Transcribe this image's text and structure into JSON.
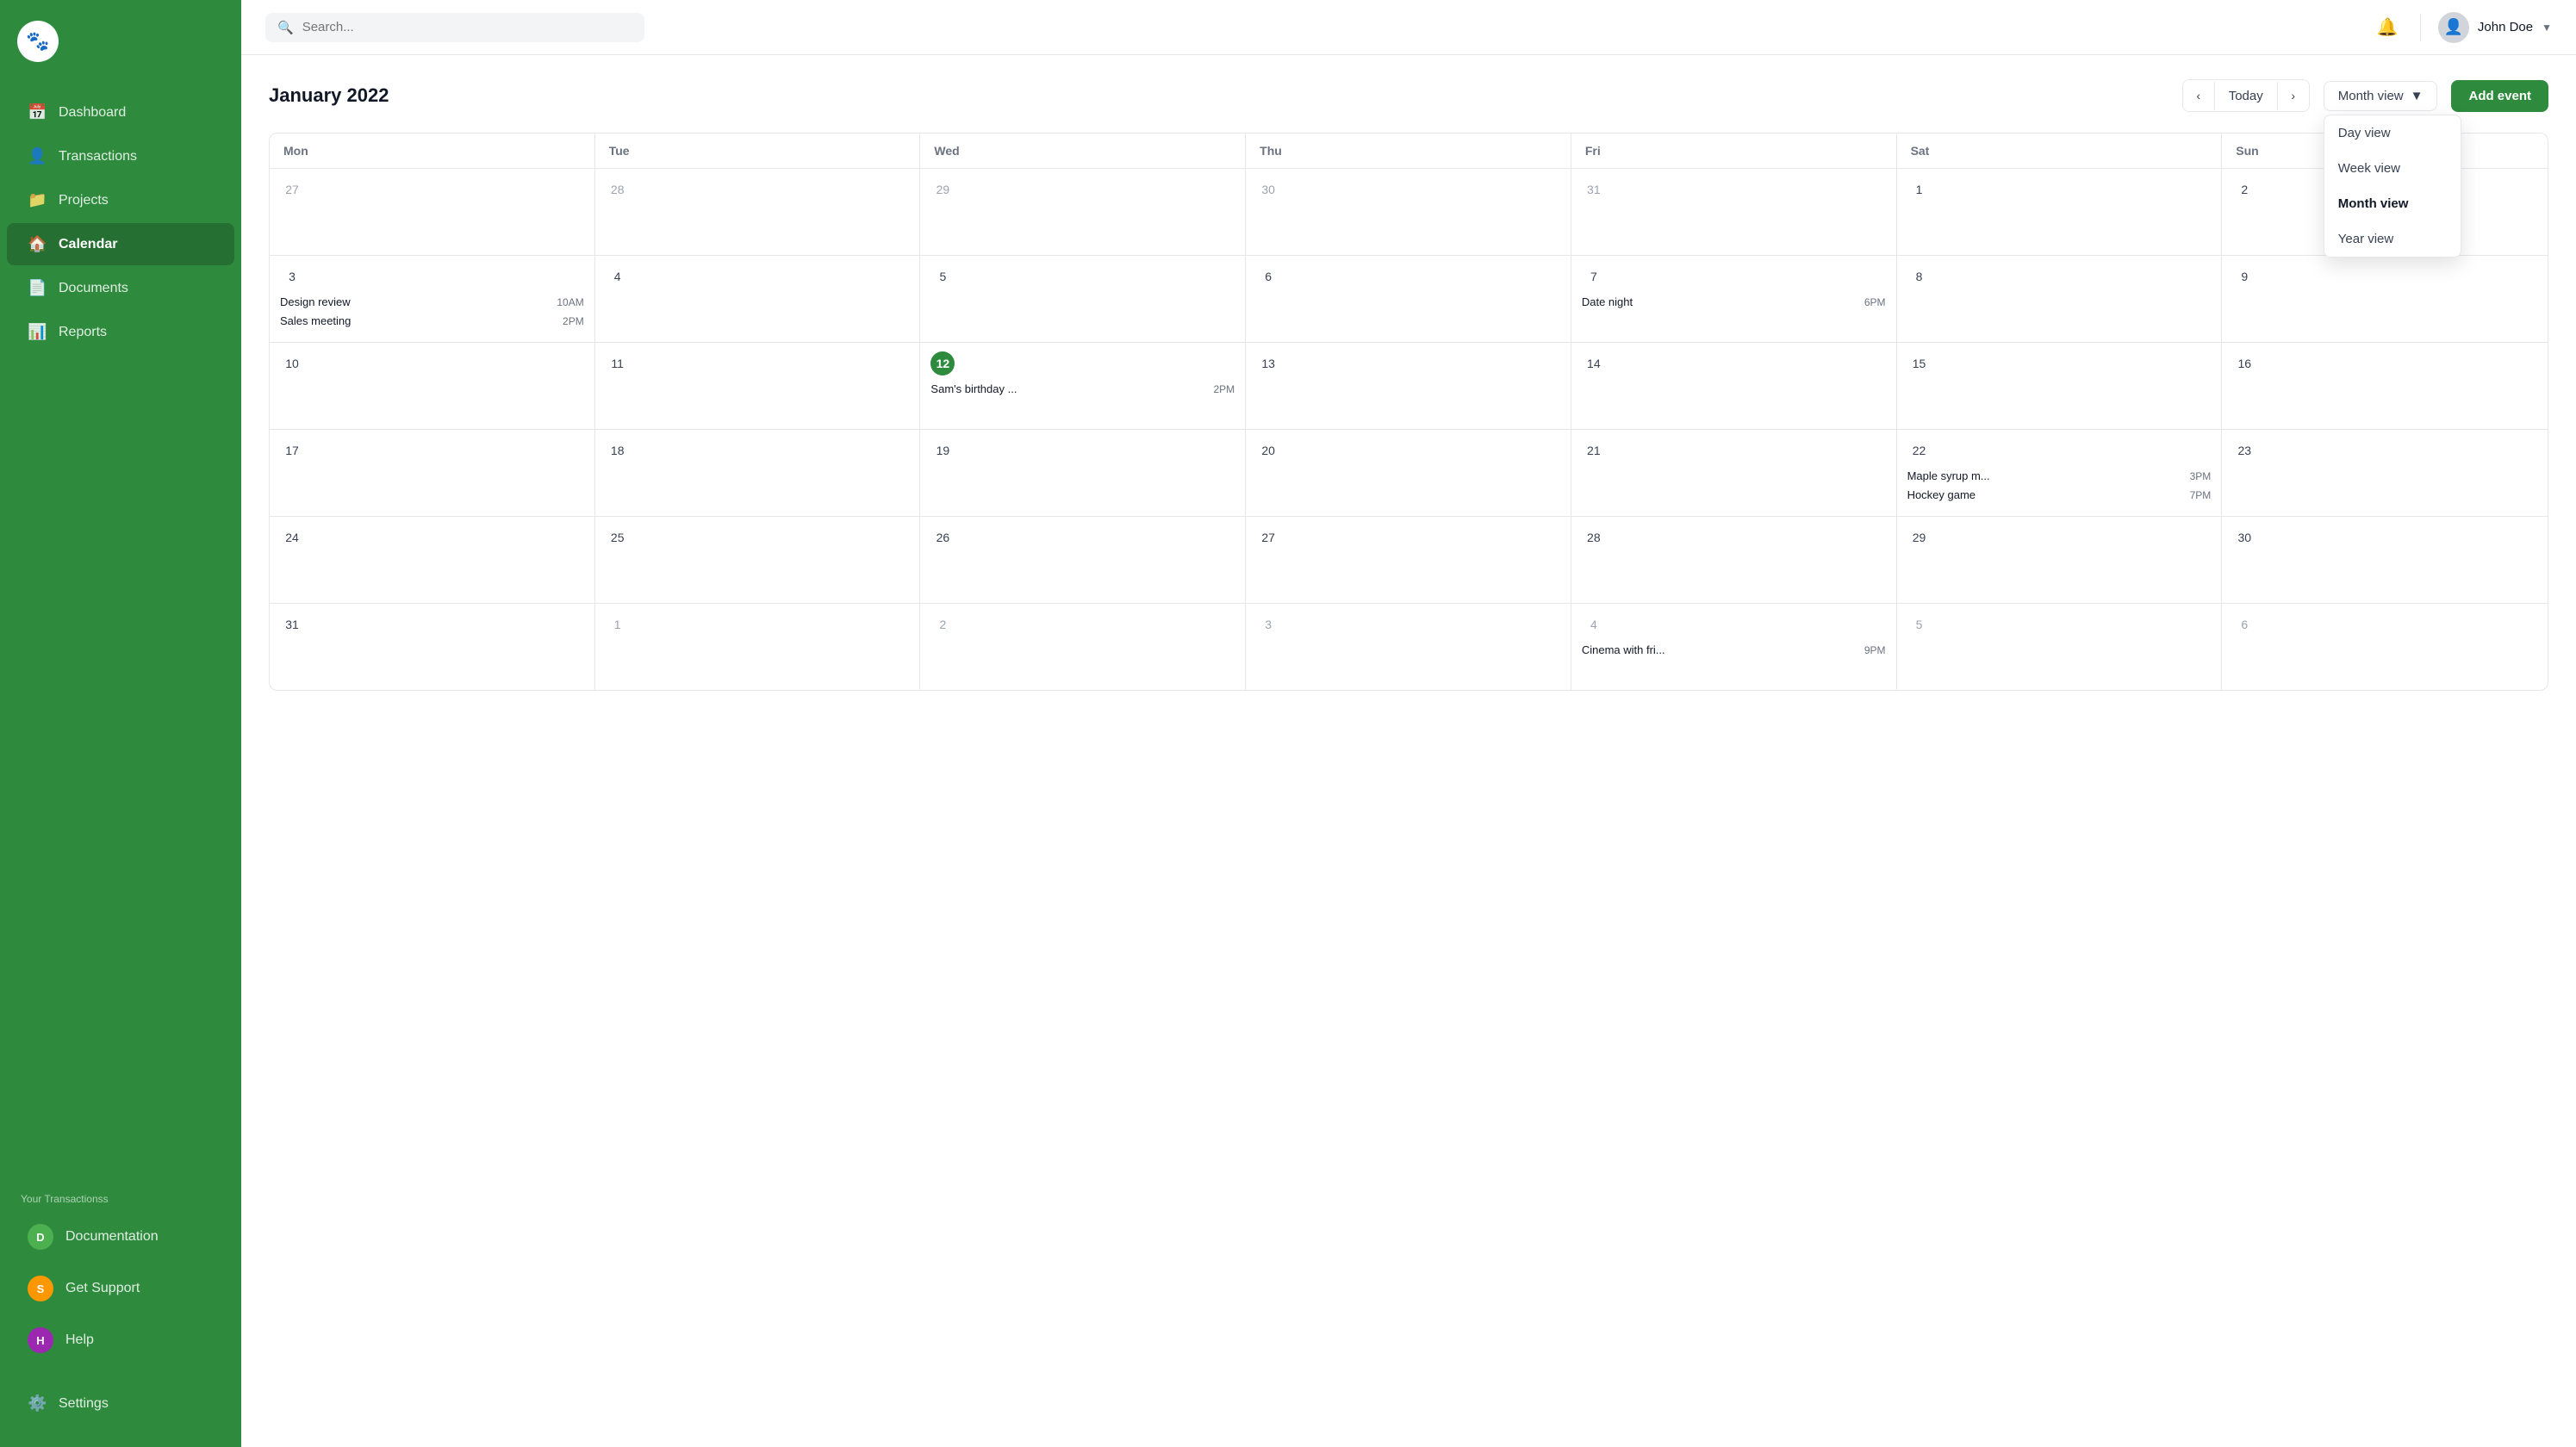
{
  "sidebar": {
    "logo": "🐾",
    "nav_items": [
      {
        "id": "dashboard",
        "label": "Dashboard",
        "icon": "📅",
        "active": false
      },
      {
        "id": "transactions",
        "label": "Transactions",
        "icon": "👤",
        "active": false
      },
      {
        "id": "projects",
        "label": "Projects",
        "icon": "📁",
        "active": false
      },
      {
        "id": "calendar",
        "label": "Calendar",
        "icon": "🏠",
        "active": true
      },
      {
        "id": "documents",
        "label": "Documents",
        "icon": "📄",
        "active": false
      },
      {
        "id": "reports",
        "label": "Reports",
        "icon": "📊",
        "active": false
      }
    ],
    "section_label": "Your Transactionss",
    "sub_items": [
      {
        "id": "documentation",
        "label": "Documentation",
        "avatar_letter": "D",
        "avatar_color": "#4CAF50"
      },
      {
        "id": "get-support",
        "label": "Get Support",
        "avatar_letter": "S",
        "avatar_color": "#FF9800"
      },
      {
        "id": "help",
        "label": "Help",
        "avatar_letter": "H",
        "avatar_color": "#9C27B0"
      }
    ],
    "bottom_items": [
      {
        "id": "settings",
        "label": "Settings",
        "icon": "⚙️"
      }
    ]
  },
  "header": {
    "search_placeholder": "Search...",
    "user_name": "John Doe"
  },
  "calendar": {
    "title": "January 2022",
    "today_label": "Today",
    "view_label": "Month view",
    "add_event_label": "Add event",
    "view_options": [
      {
        "id": "day",
        "label": "Day view"
      },
      {
        "id": "week",
        "label": "Week view"
      },
      {
        "id": "month",
        "label": "Month view",
        "selected": true
      },
      {
        "id": "year",
        "label": "Year view"
      }
    ],
    "weekdays": [
      "Mon",
      "Tue",
      "Wed",
      "Thu",
      "Fri",
      "Sat",
      "Sun"
    ],
    "weeks": [
      {
        "days": [
          {
            "num": "27",
            "other": true,
            "events": []
          },
          {
            "num": "28",
            "other": true,
            "events": []
          },
          {
            "num": "29",
            "other": true,
            "events": []
          },
          {
            "num": "30",
            "other": true,
            "events": []
          },
          {
            "num": "31",
            "other": true,
            "events": []
          },
          {
            "num": "1",
            "other": false,
            "events": []
          },
          {
            "num": "2",
            "other": false,
            "events": []
          }
        ]
      },
      {
        "days": [
          {
            "num": "3",
            "other": false,
            "events": [
              {
                "name": "Design review",
                "time": "10AM"
              },
              {
                "name": "Sales meeting",
                "time": "2PM"
              }
            ]
          },
          {
            "num": "4",
            "other": false,
            "events": []
          },
          {
            "num": "5",
            "other": false,
            "events": []
          },
          {
            "num": "6",
            "other": false,
            "events": []
          },
          {
            "num": "7",
            "other": false,
            "events": [
              {
                "name": "Date night",
                "time": "6PM"
              }
            ]
          },
          {
            "num": "8",
            "other": false,
            "events": []
          },
          {
            "num": "9",
            "other": false,
            "events": []
          }
        ]
      },
      {
        "days": [
          {
            "num": "10",
            "other": false,
            "events": []
          },
          {
            "num": "11",
            "other": false,
            "events": []
          },
          {
            "num": "12",
            "other": false,
            "today": true,
            "events": [
              {
                "name": "Sam's birthday ...",
                "time": "2PM"
              }
            ]
          },
          {
            "num": "13",
            "other": false,
            "events": []
          },
          {
            "num": "14",
            "other": false,
            "events": []
          },
          {
            "num": "15",
            "other": false,
            "events": []
          },
          {
            "num": "16",
            "other": false,
            "events": []
          }
        ]
      },
      {
        "days": [
          {
            "num": "17",
            "other": false,
            "events": []
          },
          {
            "num": "18",
            "other": false,
            "events": []
          },
          {
            "num": "19",
            "other": false,
            "events": []
          },
          {
            "num": "20",
            "other": false,
            "events": []
          },
          {
            "num": "21",
            "other": false,
            "events": []
          },
          {
            "num": "22",
            "other": false,
            "events": [
              {
                "name": "Maple syrup m...",
                "time": "3PM"
              },
              {
                "name": "Hockey game",
                "time": "7PM"
              }
            ]
          },
          {
            "num": "23",
            "other": false,
            "events": []
          }
        ]
      },
      {
        "days": [
          {
            "num": "24",
            "other": false,
            "events": []
          },
          {
            "num": "25",
            "other": false,
            "events": []
          },
          {
            "num": "26",
            "other": false,
            "events": []
          },
          {
            "num": "27",
            "other": false,
            "events": []
          },
          {
            "num": "28",
            "other": false,
            "events": []
          },
          {
            "num": "29",
            "other": false,
            "events": []
          },
          {
            "num": "30",
            "other": false,
            "events": []
          }
        ]
      },
      {
        "days": [
          {
            "num": "31",
            "other": false,
            "events": []
          },
          {
            "num": "1",
            "other": true,
            "events": []
          },
          {
            "num": "2",
            "other": true,
            "events": []
          },
          {
            "num": "3",
            "other": true,
            "events": []
          },
          {
            "num": "4",
            "other": true,
            "events": [
              {
                "name": "Cinema with fri...",
                "time": "9PM"
              }
            ]
          },
          {
            "num": "5",
            "other": true,
            "events": []
          },
          {
            "num": "6",
            "other": true,
            "events": []
          }
        ]
      }
    ]
  }
}
